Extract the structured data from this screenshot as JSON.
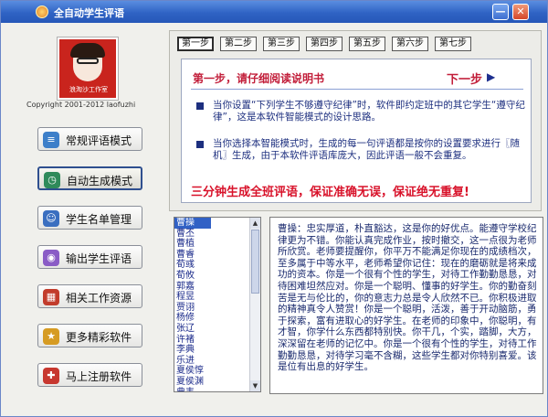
{
  "window": {
    "title": "全自动学生评语",
    "minimize": "—",
    "close": "✕",
    "colors": {
      "titlebar": "#2f63c4",
      "accent_red": "#c21e3a",
      "text_blue": "#1d2f7f"
    }
  },
  "sidebar": {
    "logo_text": "浪淘沙工作室",
    "copyright": "Copyright 2001-2012 laofuzhi",
    "items": [
      {
        "label": "常规评语模式",
        "icon": "book-icon",
        "glyph": "≡",
        "color": "#3d7fc9"
      },
      {
        "label": "自动生成模式",
        "icon": "clock-icon",
        "glyph": "◷",
        "color": "#2f8a5a"
      },
      {
        "label": "学生名单管理",
        "icon": "users-icon",
        "glyph": "☺",
        "color": "#3b6fc0"
      },
      {
        "label": "输出学生评语",
        "icon": "output-icon",
        "glyph": "◉",
        "color": "#8a5cc6"
      },
      {
        "label": "相关工作资源",
        "icon": "resources-icon",
        "glyph": "▦",
        "color": "#c23c2c"
      },
      {
        "label": "更多精彩软件",
        "icon": "star-icon",
        "glyph": "★",
        "color": "#d69b22"
      },
      {
        "label": "马上注册软件",
        "icon": "register-icon",
        "glyph": "✚",
        "color": "#c7372f"
      }
    ]
  },
  "steps": {
    "tabs": [
      "第一步",
      "第二步",
      "第三步",
      "第四步",
      "第五步",
      "第六步",
      "第七步"
    ],
    "active_index": 0,
    "heading": "第一步，请仔细阅读说明书",
    "next_label": "下一步",
    "next_arrow": "▶",
    "paragraphs": [
      "当你设置“下列学生不够遵守纪律”时，软件即约定班中的其它学生“遵守纪律”，这是本软件智能模式的设计思路。",
      "当你选择本智能模式时，生成的每一句评语都是按你的设置要求进行〖随机〗生成，由于本软件评语库庞大，因此评语一般不会重复。"
    ],
    "slogan": "三分钟生成全班评语，保证准确无误，保证绝无重复!"
  },
  "students": {
    "items": [
      "曹操",
      "曹丕",
      "曹植",
      "曹睿",
      "荀彧",
      "荀攸",
      "郭嘉",
      "程昱",
      "贾诩",
      "杨修",
      "张辽",
      "许褚",
      "李典",
      "乐进",
      "夏侯惇",
      "夏侯渊",
      "典韦"
    ],
    "selected_index": 0,
    "scroll_up": "▲",
    "scroll_down": "▼"
  },
  "comment": {
    "text": "曹操：忠实厚道，朴直豁达，这是你的好优点。能遵守学校纪律更为不错。你能认真完成作业，按时撤交，这一点很为老师所欣赏。老师要提醒你，你平万不能满足你现在的成绩档次，至多属于中等水平，老师希望你记住：现在的磨砺就是将来成功的资本。你是一个很有个性的学生，对待工作勤勤恳恳，对待困难坦然应对。你是一个聪明、懂事的好学生。你的勤奋刻苦是无与伦比的，你的意志力总是令人欣然不已。你积极进取的精神真令人赞赏！你是一个聪明，活泼，善于开动脑筋，勇于探索，富有进取心的好学生。在老师的印象中，你聪明，有才智，你学什么东西都特别快。你干几，个实，踏脚，大方，深深留在老师的记忆中。你是一个很有个性的学生，对待工作勤勤恳恳，对待学习毫不含糊，这些学生都对你特别喜爱。该是位有出息的好学生。"
  }
}
